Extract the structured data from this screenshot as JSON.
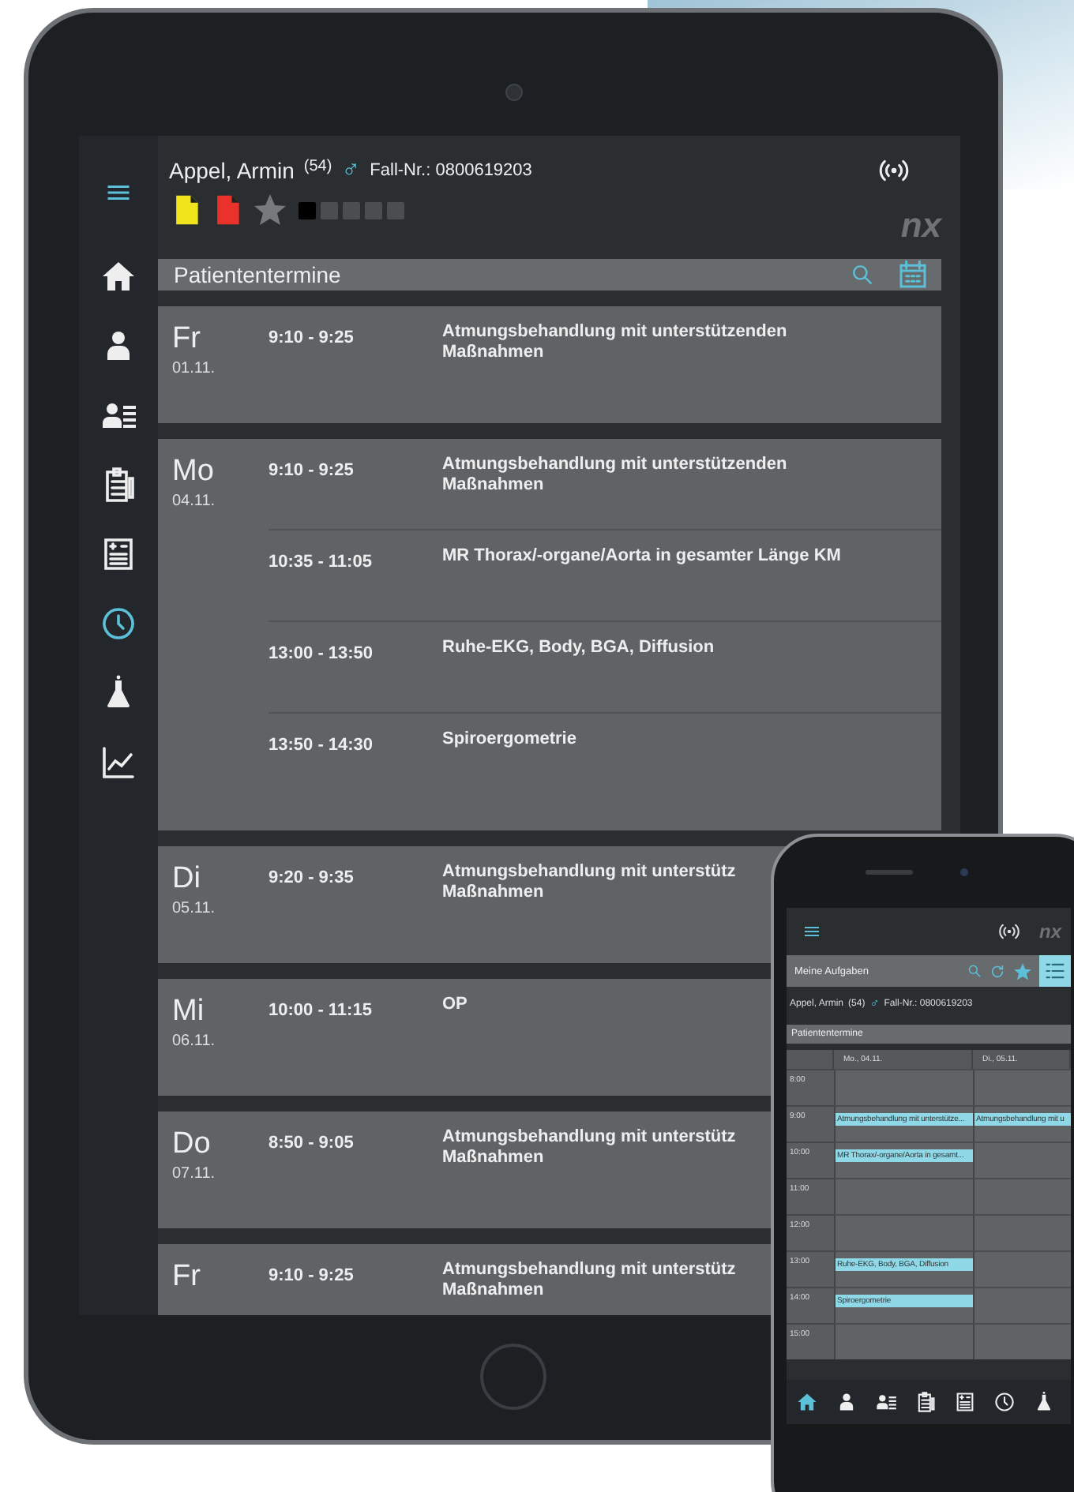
{
  "tablet": {
    "sidebar": {
      "items": [
        {
          "kind": "home",
          "selected": false
        },
        {
          "kind": "patient",
          "selected": false
        },
        {
          "kind": "patient-list",
          "selected": false
        },
        {
          "kind": "clipboard",
          "selected": false
        },
        {
          "kind": "form",
          "selected": false
        },
        {
          "kind": "clock",
          "selected": true
        },
        {
          "kind": "flask",
          "selected": false
        },
        {
          "kind": "chart",
          "selected": false
        }
      ]
    },
    "header": {
      "patient_name": "Appel, Armin",
      "age": "(54)",
      "gender_symbol": "♂",
      "case_number": "Fall-Nr.: 0800619203",
      "logo": "nx",
      "starred": false,
      "documents": [
        {
          "color": "#f0e41c"
        },
        {
          "color": "#e8322a"
        }
      ],
      "markers": [
        {
          "color": "#000000"
        },
        {
          "color": "#4b4e51"
        },
        {
          "color": "#4b4e51"
        },
        {
          "color": "#4b4e51"
        },
        {
          "color": "#4b4e51"
        }
      ]
    },
    "title_bar": {
      "title": "Patiententermine"
    },
    "days": [
      {
        "day": "Fr",
        "date": "01.11.",
        "appointments": [
          {
            "time": "9:10 - 9:25",
            "title": "Atmungsbehandlung mit unterstützenden\nMaßnahmen"
          }
        ]
      },
      {
        "day": "Mo",
        "date": "04.11.",
        "appointments": [
          {
            "time": "9:10 - 9:25",
            "title": "Atmungsbehandlung mit unterstützenden\nMaßnahmen"
          },
          {
            "time": "10:35 - 11:05",
            "title": "MR Thorax/-organe/Aorta in gesamter Länge KM"
          },
          {
            "time": "13:00 - 13:50",
            "title": "Ruhe-EKG, Body, BGA, Diffusion"
          },
          {
            "time": "13:50 - 14:30",
            "title": "Spiroergometrie"
          }
        ]
      },
      {
        "day": "Di",
        "date": "05.11.",
        "appointments": [
          {
            "time": "9:20 - 9:35",
            "title": "Atmungsbehandlung mit unterstütz\nMaßnahmen"
          }
        ]
      },
      {
        "day": "Mi",
        "date": "06.11.",
        "appointments": [
          {
            "time": "10:00 - 11:15",
            "title": "OP"
          }
        ]
      },
      {
        "day": "Do",
        "date": "07.11.",
        "appointments": [
          {
            "time": "8:50 - 9:05",
            "title": "Atmungsbehandlung mit unterstütz\nMaßnahmen"
          }
        ]
      },
      {
        "day": "Fr",
        "appointments": [
          {
            "time": "9:10 - 9:25",
            "title": "Atmungsbehandlung mit unterstütz\nMaßnahmen"
          }
        ]
      }
    ]
  },
  "phone": {
    "logo": "nx",
    "toolbar": {
      "title": "Meine Aufgaben",
      "starred": true,
      "list_view_selected": true
    },
    "patient": {
      "patient_name": "Appel, Armin",
      "age": "(54)",
      "gender_symbol": "♂",
      "case_number": "Fall-Nr.: 0800619203"
    },
    "title_bar": {
      "title": "Patiententermine"
    },
    "calendar": {
      "columns": [
        "Mo., 04.11.",
        "Di., 05.11."
      ],
      "rows": [
        {
          "time": "8:00",
          "cells": [
            {},
            {}
          ]
        },
        {
          "time": "9:00",
          "cells": [
            {
              "event": "Atmungsbehandlung mit unterstütze..."
            },
            {
              "event": "Atmungsbehandlung mit u"
            }
          ]
        },
        {
          "time": "10:00",
          "cells": [
            {
              "event": "MR Thorax/-organe/Aorta in gesamt..."
            },
            {}
          ]
        },
        {
          "time": "11:00",
          "cells": [
            {},
            {}
          ]
        },
        {
          "time": "12:00",
          "cells": [
            {},
            {}
          ]
        },
        {
          "time": "13:00",
          "cells": [
            {
              "event": "Ruhe-EKG, Body, BGA, Diffusion"
            },
            {}
          ]
        },
        {
          "time": "14:00",
          "cells": [
            {
              "event": "Spiroergometrie"
            },
            {}
          ]
        },
        {
          "time": "15:00",
          "cells": [
            {},
            {}
          ]
        }
      ]
    },
    "nav": [
      {
        "kind": "home",
        "selected": true
      },
      {
        "kind": "patient",
        "selected": false
      },
      {
        "kind": "patient-list",
        "selected": false
      },
      {
        "kind": "clipboard",
        "selected": false
      },
      {
        "kind": "form",
        "selected": false
      },
      {
        "kind": "clock",
        "selected": false
      },
      {
        "kind": "flask",
        "selected": false
      }
    ]
  }
}
